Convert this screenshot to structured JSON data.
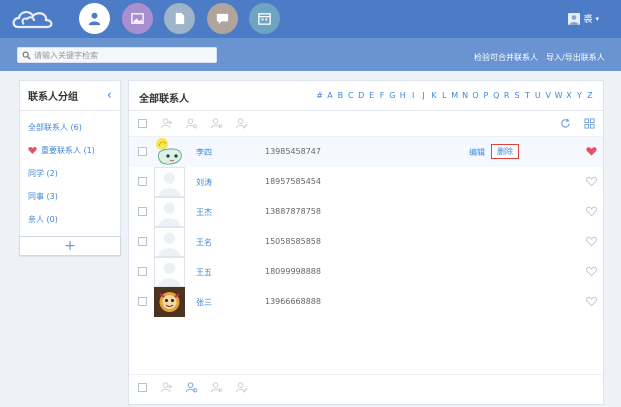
{
  "user": {
    "name": "裘"
  },
  "search": {
    "placeholder": "请输入关键字检索"
  },
  "top_links": [
    "检验可合并联系人",
    "导入/导出联系人"
  ],
  "sidebar": {
    "title": "联系人分组",
    "groups": [
      {
        "label": "全部联系人 (6)"
      },
      {
        "label": "重要联系人 (1)"
      },
      {
        "label": "同学 (2)"
      },
      {
        "label": "同事 (3)"
      },
      {
        "label": "亲人 (0)"
      }
    ],
    "add_label": "+"
  },
  "main": {
    "title": "全部联系人",
    "alphabet": [
      "#",
      "A",
      "B",
      "C",
      "D",
      "E",
      "F",
      "G",
      "H",
      "I",
      "J",
      "K",
      "L",
      "M",
      "N",
      "O",
      "P",
      "Q",
      "R",
      "S",
      "T",
      "U",
      "V",
      "W",
      "X",
      "Y",
      "Z"
    ],
    "actions": {
      "edit": "编辑",
      "delete": "删除"
    },
    "contacts": [
      {
        "name": "李四",
        "phone": "13985458747",
        "favorite": true
      },
      {
        "name": "刘涛",
        "phone": "18957585454",
        "favorite": false
      },
      {
        "name": "王杰",
        "phone": "13887878758",
        "favorite": false
      },
      {
        "name": "王名",
        "phone": "15058585858",
        "favorite": false
      },
      {
        "name": "王五",
        "phone": "18099998888",
        "favorite": false
      },
      {
        "name": "张三",
        "phone": "13966668888",
        "favorite": false
      }
    ]
  },
  "colors": {
    "topbar": "#4c7cc6",
    "searchbar": "#6a93d2",
    "link": "#3f87d9",
    "heart_active": "#e55264"
  }
}
